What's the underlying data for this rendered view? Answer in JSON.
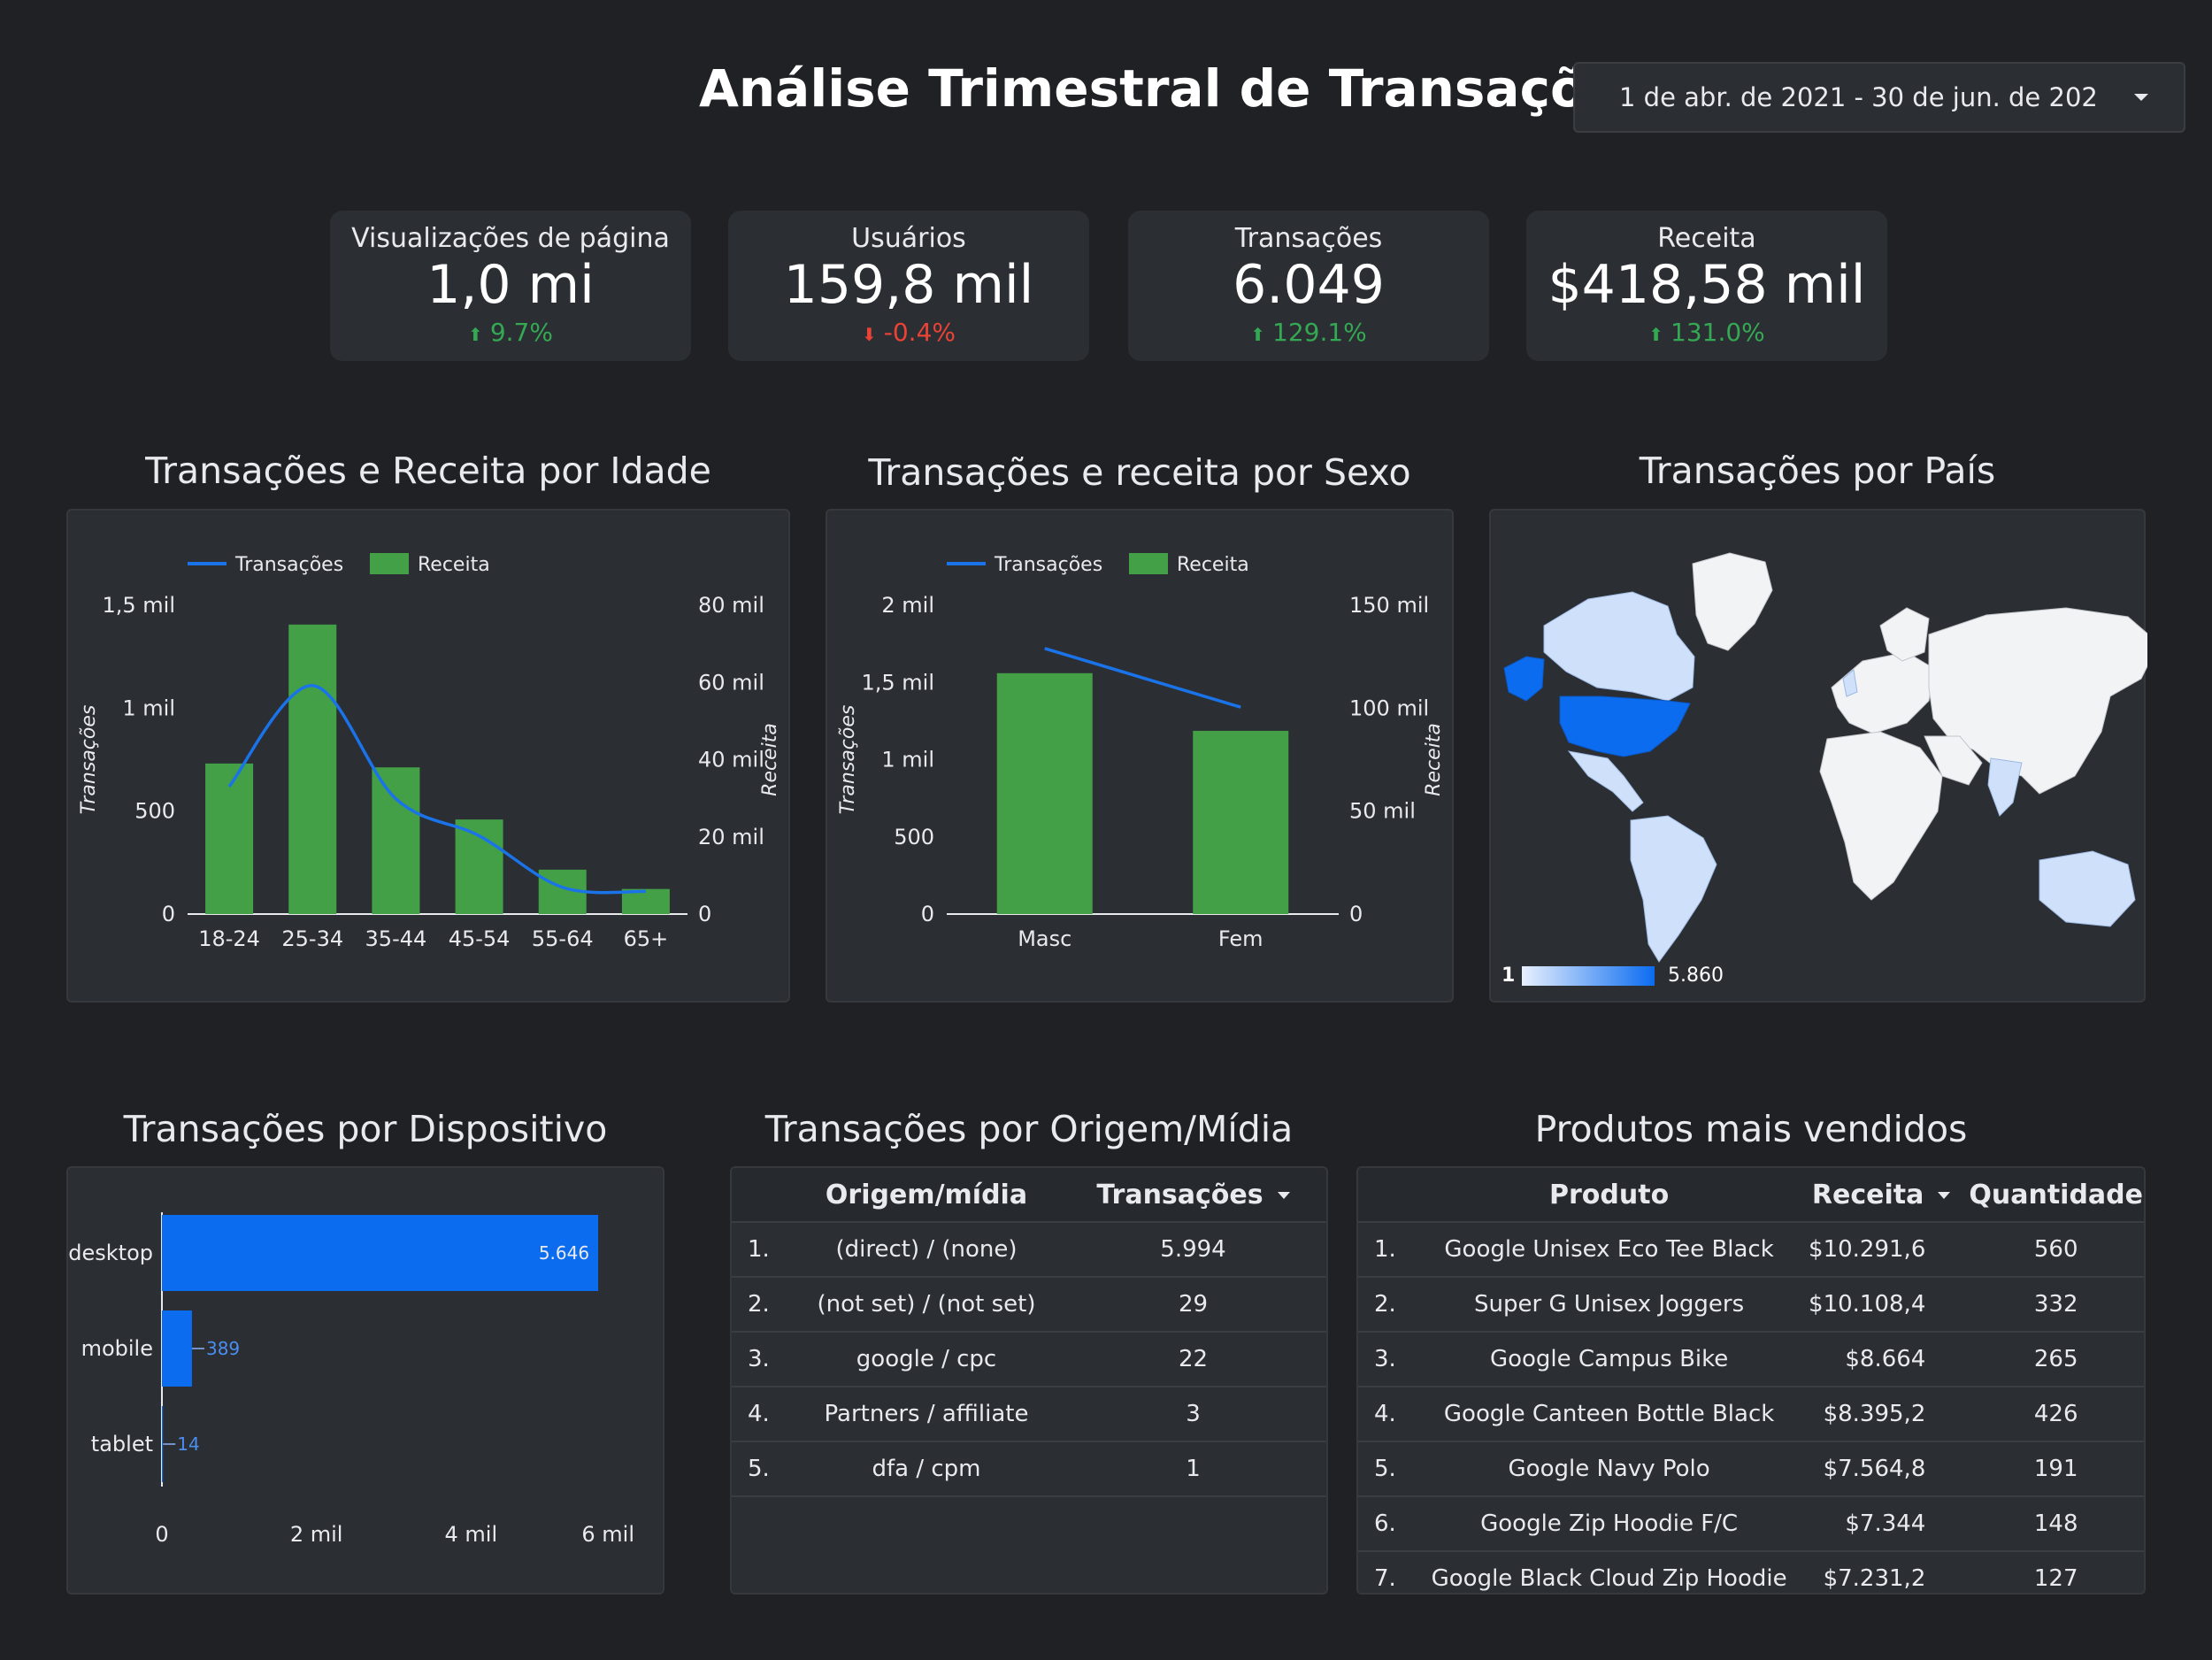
{
  "header": {
    "title": "Análise Trimestral de Transações",
    "date_range": "1 de abr. de 2021 - 30 de jun. de 202"
  },
  "kpis": [
    {
      "label": "Visualizações de página",
      "value": "1,0 mi",
      "delta": "9.7%",
      "direction": "up"
    },
    {
      "label": "Usuários",
      "value": "159,8 mil",
      "delta": "-0.4%",
      "direction": "down"
    },
    {
      "label": "Transações",
      "value": "6.049",
      "delta": "129.1%",
      "direction": "up"
    },
    {
      "label": "Receita",
      "value": "$418,58 mil",
      "delta": "131.0%",
      "direction": "up"
    }
  ],
  "colors": {
    "background": "#202124",
    "panel": "#2b2e33",
    "bar_green": "#43a047",
    "line_blue": "#1a73e8",
    "bar_blue": "#0b6cf0",
    "positive": "#34a853",
    "negative": "#ea4335"
  },
  "sections": {
    "age": "Transações e Receita por Idade",
    "sex": "Transações e receita por Sexo",
    "country": "Transações por País",
    "device": "Transações por Dispositivo",
    "source": "Transações por Origem/Mídia",
    "products": "Produtos mais vendidos"
  },
  "chart_data": [
    {
      "type": "bar",
      "id": "age",
      "title": "Transações e Receita por Idade",
      "categories": [
        "18-24",
        "25-34",
        "35-44",
        "45-54",
        "55-64",
        "65+"
      ],
      "series": [
        {
          "name": "Transações",
          "kind": "line",
          "axis": "left",
          "values": [
            620,
            1110,
            560,
            380,
            130,
            110
          ]
        },
        {
          "name": "Receita",
          "kind": "bar",
          "axis": "right",
          "values": [
            39000,
            75000,
            38000,
            24500,
            11500,
            6500
          ]
        }
      ],
      "ylabel": "Transações",
      "y2label": "Receita",
      "ylim": [
        0,
        1500
      ],
      "y2lim": [
        0,
        80000
      ],
      "yticks": [
        "0",
        "500",
        "1 mil",
        "1,5 mil"
      ],
      "y2ticks": [
        "0",
        "20 mil",
        "40 mil",
        "60 mil",
        "80 mil"
      ],
      "legend": "top-left"
    },
    {
      "type": "bar",
      "id": "sex",
      "title": "Transações e receita por Sexo",
      "categories": [
        "Masc",
        "Fem"
      ],
      "series": [
        {
          "name": "Transações",
          "kind": "line",
          "axis": "left",
          "values": [
            1720,
            1340
          ]
        },
        {
          "name": "Receita",
          "kind": "bar",
          "axis": "right",
          "values": [
            117000,
            89000
          ]
        }
      ],
      "ylabel": "Transações",
      "y2label": "Receita",
      "ylim": [
        0,
        2000
      ],
      "y2lim": [
        0,
        150000
      ],
      "yticks": [
        "0",
        "500",
        "1 mil",
        "1,5 mil",
        "2 mil"
      ],
      "y2ticks": [
        "0",
        "50 mil",
        "100 mil",
        "150 mil"
      ],
      "legend": "top-left"
    },
    {
      "type": "bar",
      "id": "device",
      "title": "Transações por Dispositivo",
      "orientation": "horizontal",
      "categories": [
        "desktop",
        "mobile",
        "tablet"
      ],
      "values": [
        5646,
        389,
        14
      ],
      "data_labels": [
        "5.646",
        "389",
        "14"
      ],
      "xlim": [
        0,
        6000
      ],
      "xticks": [
        "0",
        "2 mil",
        "4 mil",
        "6 mil"
      ]
    }
  ],
  "map": {
    "legend_min": "1",
    "legend_max": "5.860"
  },
  "source_table": {
    "headers": [
      "Origem/mídia",
      "Transações"
    ],
    "rows": [
      {
        "rank": "1.",
        "source": "(direct) / (none)",
        "transactions": "5.994"
      },
      {
        "rank": "2.",
        "source": "(not set) / (not set)",
        "transactions": "29"
      },
      {
        "rank": "3.",
        "source": "google / cpc",
        "transactions": "22"
      },
      {
        "rank": "4.",
        "source": "Partners / affiliate",
        "transactions": "3"
      },
      {
        "rank": "5.",
        "source": "dfa / cpm",
        "transactions": "1"
      }
    ]
  },
  "products_table": {
    "headers": [
      "Produto",
      "Receita",
      "Quantidade"
    ],
    "rows": [
      {
        "rank": "1.",
        "product": "Google Unisex Eco Tee Black",
        "revenue": "$10.291,6",
        "qty": "560"
      },
      {
        "rank": "2.",
        "product": "Super G Unisex Joggers",
        "revenue": "$10.108,4",
        "qty": "332"
      },
      {
        "rank": "3.",
        "product": "Google Campus Bike",
        "revenue": "$8.664",
        "qty": "265"
      },
      {
        "rank": "4.",
        "product": "Google Canteen Bottle Black",
        "revenue": "$8.395,2",
        "qty": "426"
      },
      {
        "rank": "5.",
        "product": "Google Navy Polo",
        "revenue": "$7.564,8",
        "qty": "191"
      },
      {
        "rank": "6.",
        "product": "Google Zip Hoodie F/C",
        "revenue": "$7.344",
        "qty": "148"
      },
      {
        "rank": "7.",
        "product": "Google Black Cloud Zip Hoodie",
        "revenue": "$7.231,2",
        "qty": "127"
      }
    ]
  }
}
